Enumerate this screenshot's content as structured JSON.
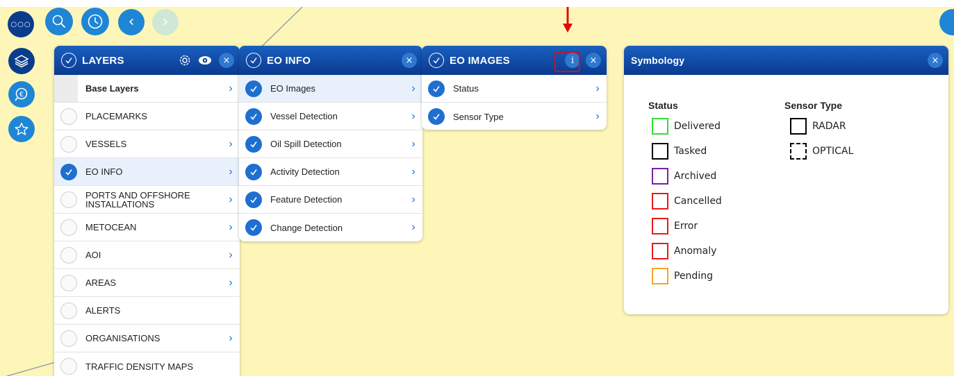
{
  "colors": {
    "map_bg": "#fdf6b8",
    "header": "#0a3a8f",
    "accent": "#1e6fd0",
    "annotation": "#e20a0a"
  },
  "toolbar": {
    "top": [
      {
        "name": "more-icon",
        "glyph": "○○○"
      },
      {
        "name": "search-icon",
        "glyph": ""
      },
      {
        "name": "clock-icon",
        "glyph": ""
      },
      {
        "name": "back-icon",
        "glyph": "‹"
      },
      {
        "name": "forward-icon",
        "glyph": "›"
      }
    ],
    "side": [
      {
        "name": "layers-icon"
      },
      {
        "name": "search-money-icon"
      },
      {
        "name": "star-icon"
      }
    ]
  },
  "layers_panel": {
    "title": "LAYERS",
    "items": [
      {
        "label": "Base Layers",
        "checked": false,
        "chevron": true,
        "bold": true
      },
      {
        "label": "PLACEMARKS",
        "checked": false,
        "chevron": false
      },
      {
        "label": "VESSELS",
        "checked": false,
        "chevron": true
      },
      {
        "label": "EO INFO",
        "checked": true,
        "chevron": true,
        "selected": true
      },
      {
        "label": "PORTS AND OFFSHORE INSTALLATIONS",
        "checked": false,
        "chevron": true
      },
      {
        "label": "METOCEAN",
        "checked": false,
        "chevron": true
      },
      {
        "label": "AOI",
        "checked": false,
        "chevron": true
      },
      {
        "label": "AREAS",
        "checked": false,
        "chevron": true
      },
      {
        "label": "ALERTS",
        "checked": false,
        "chevron": false
      },
      {
        "label": "ORGANISATIONS",
        "checked": false,
        "chevron": true
      },
      {
        "label": "TRAFFIC DENSITY MAPS",
        "checked": false,
        "chevron": false
      }
    ]
  },
  "eo_info_panel": {
    "title": "EO INFO",
    "items": [
      {
        "label": "EO Images",
        "checked": true,
        "selected": true
      },
      {
        "label": "Vessel Detection",
        "checked": true
      },
      {
        "label": "Oil Spill Detection",
        "checked": true
      },
      {
        "label": "Activity Detection",
        "checked": true
      },
      {
        "label": "Feature Detection",
        "checked": true
      },
      {
        "label": "Change Detection",
        "checked": true
      }
    ]
  },
  "eo_images_panel": {
    "title": "EO IMAGES",
    "info_label": "i",
    "items": [
      {
        "label": "Status",
        "checked": true
      },
      {
        "label": "Sensor Type",
        "checked": true
      }
    ]
  },
  "symbology_panel": {
    "title": "Symbology",
    "status_heading": "Status",
    "status_items": [
      {
        "label": "Delivered",
        "color": "#2ee02e"
      },
      {
        "label": "Tasked",
        "color": "#000000"
      },
      {
        "label": "Archived",
        "color": "#7a1fa2"
      },
      {
        "label": "Cancelled",
        "color": "#e51c1c"
      },
      {
        "label": "Error",
        "color": "#e51c1c"
      },
      {
        "label": "Anomaly",
        "color": "#e51c1c"
      },
      {
        "label": "Pending",
        "color": "#f5a623"
      }
    ],
    "sensor_heading": "Sensor Type",
    "sensor_items": [
      {
        "label": "RADAR",
        "style": "solid"
      },
      {
        "label": "OPTICAL",
        "style": "dashed"
      }
    ]
  },
  "close_glyph": "×"
}
